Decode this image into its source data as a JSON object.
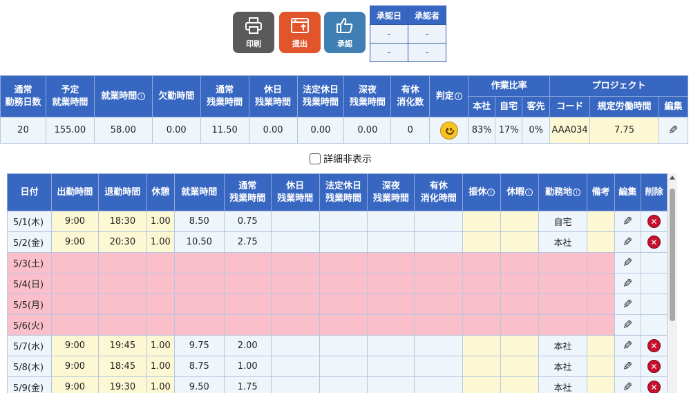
{
  "toolbar": {
    "print_label": "印刷",
    "submit_label": "提出",
    "approve_label": "承認"
  },
  "approval": {
    "headers": [
      "承認日",
      "承認者"
    ],
    "rows": [
      [
        "-",
        "-"
      ],
      [
        "-",
        "-"
      ]
    ]
  },
  "summary": {
    "headers": {
      "regular_days": "通常\n勤務日数",
      "scheduled_hours": "予定\n就業時間",
      "work_hours": "就業時間",
      "absence_hours": "欠勤時間",
      "regular_overtime": "通常\n残業時間",
      "holiday_overtime": "休日\n残業時間",
      "legal_holiday_overtime": "法定休日\n残業時間",
      "late_night_overtime": "深夜\n残業時間",
      "paid_leave": "有休\n消化数",
      "judgement": "判定",
      "work_ratio": "作業比率",
      "ratio_office": "本社",
      "ratio_home": "自宅",
      "ratio_client": "客先",
      "project": "プロジェクト",
      "project_code": "コード",
      "project_hours": "規定労働時間",
      "edit": "編集"
    },
    "values": {
      "regular_days": "20",
      "scheduled_hours": "155.00",
      "work_hours": "58.00",
      "absence_hours": "0.00",
      "regular_overtime": "11.50",
      "holiday_overtime": "0.00",
      "legal_holiday_overtime": "0.00",
      "late_night_overtime": "0.00",
      "paid_leave": "0",
      "judgement_icon": "smiley-face-icon",
      "ratio_office": "83%",
      "ratio_home": "17%",
      "ratio_client": "0%",
      "project_code": "AAA034",
      "project_hours": "7.75"
    }
  },
  "toggle": {
    "label": "詳細非表示",
    "checked": false
  },
  "daily": {
    "headers": {
      "date": "日付",
      "start": "出勤時間",
      "end": "退勤時間",
      "break": "休憩",
      "work": "就業時間",
      "regular_overtime": "通常\n残業時間",
      "holiday_overtime": "休日\n残業時間",
      "legal_holiday_overtime": "法定休日\n残業時間",
      "late_night_overtime": "深夜\n残業時間",
      "paid_leave": "有休\n消化時間",
      "substitute_holiday": "振休",
      "vacation": "休暇",
      "location": "勤務地",
      "note": "備考",
      "edit": "編集",
      "delete": "削除"
    },
    "rows": [
      {
        "date": "5/1(木)",
        "start": "9:00",
        "end": "18:30",
        "break": "1.00",
        "work": "8.50",
        "overtime": "0.75",
        "location": "自宅",
        "holiday": false,
        "deletable": true
      },
      {
        "date": "5/2(金)",
        "start": "9:00",
        "end": "20:30",
        "break": "1.00",
        "work": "10.50",
        "overtime": "2.75",
        "location": "本社",
        "holiday": false,
        "deletable": true
      },
      {
        "date": "5/3(土)",
        "start": "",
        "end": "",
        "break": "",
        "work": "",
        "overtime": "",
        "location": "",
        "holiday": true,
        "deletable": false
      },
      {
        "date": "5/4(日)",
        "start": "",
        "end": "",
        "break": "",
        "work": "",
        "overtime": "",
        "location": "",
        "holiday": true,
        "deletable": false
      },
      {
        "date": "5/5(月)",
        "start": "",
        "end": "",
        "break": "",
        "work": "",
        "overtime": "",
        "location": "",
        "holiday": true,
        "deletable": false
      },
      {
        "date": "5/6(火)",
        "start": "",
        "end": "",
        "break": "",
        "work": "",
        "overtime": "",
        "location": "",
        "holiday": true,
        "deletable": false
      },
      {
        "date": "5/7(水)",
        "start": "9:00",
        "end": "19:45",
        "break": "1.00",
        "work": "9.75",
        "overtime": "2.00",
        "location": "本社",
        "holiday": false,
        "deletable": true
      },
      {
        "date": "5/8(木)",
        "start": "9:00",
        "end": "18:45",
        "break": "1.00",
        "work": "8.75",
        "overtime": "1.00",
        "location": "本社",
        "holiday": false,
        "deletable": true
      },
      {
        "date": "5/9(金)",
        "start": "9:00",
        "end": "19:30",
        "break": "1.00",
        "work": "9.50",
        "overtime": "1.75",
        "location": "本社",
        "holiday": false,
        "deletable": true
      }
    ]
  },
  "icons": {
    "print": "printer-icon",
    "submit": "submit-window-icon",
    "approve": "thumbs-up-icon",
    "edit": "pencil-icon",
    "delete": "delete-icon",
    "info": "info-icon"
  },
  "colors": {
    "header_blue": "#3867c2",
    "print_button": "#5a5a5a",
    "submit_button": "#e2542a",
    "approve_button": "#3f7fb3",
    "holiday_pink": "#fbbfcb",
    "input_yellow": "#fdf8d4",
    "cell_blue": "#eef5fb",
    "delete_red": "#c8102e"
  }
}
